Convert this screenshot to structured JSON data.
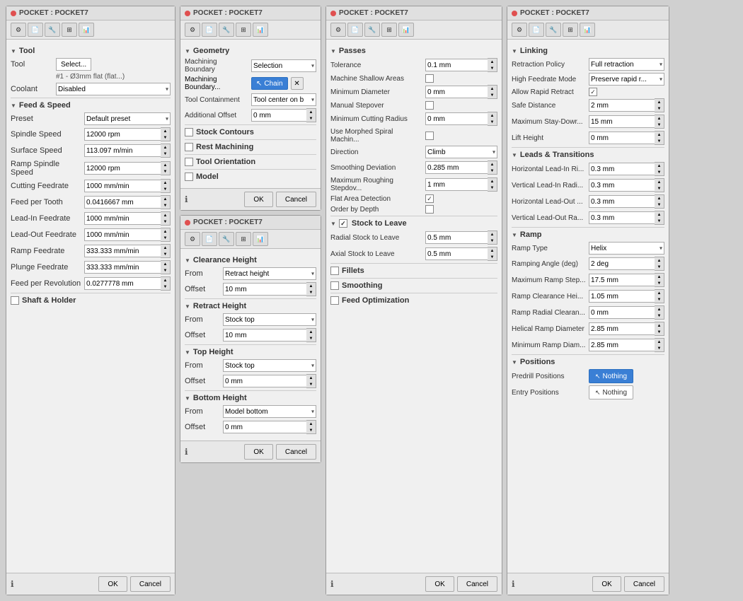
{
  "panels": {
    "panel1": {
      "title": "POCKET : POCKET7",
      "toolbar_icons": [
        "tool-icon",
        "doc-icon",
        "settings-icon",
        "grid-icon",
        "chart-icon"
      ],
      "sections": {
        "tool": {
          "label": "Tool",
          "tool_select": "Select...",
          "tool_desc": "#1 - Ø3mm flat (flat...)",
          "coolant_label": "Coolant",
          "coolant_value": "Disabled"
        },
        "feed_speed": {
          "label": "Feed & Speed",
          "preset_label": "Preset",
          "preset_value": "Default preset",
          "spindle_speed_label": "Spindle Speed",
          "spindle_speed_value": "12000 rpm",
          "surface_speed_label": "Surface Speed",
          "surface_speed_value": "113.097 m/min",
          "ramp_spindle_label": "Ramp Spindle Speed",
          "ramp_spindle_value": "12000 rpm",
          "cutting_feedrate_label": "Cutting Feedrate",
          "cutting_feedrate_value": "1000 mm/min",
          "feed_per_tooth_label": "Feed per Tooth",
          "feed_per_tooth_value": "0.0416667 mm",
          "lead_in_label": "Lead-In Feedrate",
          "lead_in_value": "1000 mm/min",
          "lead_out_label": "Lead-Out Feedrate",
          "lead_out_value": "1000 mm/min",
          "ramp_feedrate_label": "Ramp Feedrate",
          "ramp_feedrate_value": "333.333 mm/min",
          "plunge_feedrate_label": "Plunge Feedrate",
          "plunge_feedrate_value": "333.333 mm/min",
          "feed_per_rev_label": "Feed per Revolution",
          "feed_per_rev_value": "0.0277778 mm"
        },
        "shaft_holder": {
          "label": "Shaft & Holder"
        }
      },
      "ok_label": "OK",
      "cancel_label": "Cancel"
    },
    "panel2": {
      "title": "POCKET : POCKET7",
      "toolbar_icons": [
        "tool-icon",
        "doc-icon",
        "settings-icon",
        "grid-icon",
        "chart-icon"
      ],
      "sections": {
        "geometry": {
          "label": "Geometry",
          "machining_boundary_label": "Machining Boundary",
          "machining_boundary_value": "Selection",
          "machining_boundary2_label": "Machining Boundary...",
          "chain_label": "Chain",
          "tool_containment_label": "Tool Containment",
          "tool_containment_value": "Tool center on b...",
          "additional_offset_label": "Additional Offset",
          "additional_offset_value": "0 mm"
        },
        "stock_contours": {
          "label": "Stock Contours",
          "checked": false
        },
        "rest_machining": {
          "label": "Rest Machining",
          "checked": false
        },
        "tool_orientation": {
          "label": "Tool Orientation",
          "checked": false
        },
        "model": {
          "label": "Model",
          "checked": false
        }
      },
      "ok_label": "OK",
      "cancel_label": "Cancel"
    },
    "panel3": {
      "title": "POCKET : POCKET7",
      "toolbar_icons": [
        "tool-icon",
        "doc-icon",
        "settings-icon",
        "grid-icon",
        "chart-icon"
      ],
      "sections": {
        "clearance_height": {
          "label": "Clearance Height",
          "from_label": "From",
          "from_value": "Retract height",
          "offset_label": "Offset",
          "offset_value": "10 mm"
        },
        "retract_height": {
          "label": "Retract Height",
          "from_label": "From",
          "from_value": "Stock top",
          "offset_label": "Offset",
          "offset_value": "10 mm"
        },
        "top_height": {
          "label": "Top Height",
          "from_label": "From",
          "from_value": "Stock top",
          "offset_label": "Offset",
          "offset_value": "0 mm"
        },
        "bottom_height": {
          "label": "Bottom Height",
          "from_label": "From",
          "from_value": "Model bottom",
          "offset_label": "Offset",
          "offset_value": "0 mm"
        }
      },
      "ok_label": "OK",
      "cancel_label": "Cancel"
    },
    "panel4": {
      "title": "POCKET : POCKET7",
      "toolbar_icons": [
        "tool-icon",
        "doc-icon",
        "settings-icon",
        "grid-icon",
        "chart-icon"
      ],
      "sections": {
        "passes": {
          "label": "Passes",
          "tolerance_label": "Tolerance",
          "tolerance_value": "0.1 mm",
          "machine_shallow_label": "Machine Shallow Areas",
          "machine_shallow_checked": false,
          "min_diameter_label": "Minimum Diameter",
          "min_diameter_value": "0 mm",
          "manual_stepover_label": "Manual Stepover",
          "manual_stepover_checked": false,
          "min_cutting_radius_label": "Minimum Cutting Radius",
          "min_cutting_radius_value": "0 mm",
          "use_morphed_label": "Use Morphed Spiral Machin...",
          "use_morphed_checked": false,
          "direction_label": "Direction",
          "direction_value": "Climb",
          "smoothing_deviation_label": "Smoothing Deviation",
          "smoothing_deviation_value": "0.285 mm",
          "max_roughing_label": "Maximum Roughing Stepdov...",
          "max_roughing_value": "1 mm",
          "flat_area_label": "Flat Area Detection",
          "flat_area_checked": true,
          "order_by_depth_label": "Order by Depth",
          "order_by_depth_checked": false
        },
        "stock_to_leave": {
          "label": "Stock to Leave",
          "checked": true,
          "radial_label": "Radial Stock to Leave",
          "radial_value": "0.5 mm",
          "axial_label": "Axial Stock to Leave",
          "axial_value": "0.5 mm"
        },
        "fillets": {
          "label": "Fillets",
          "checked": false
        },
        "smoothing": {
          "label": "Smoothing",
          "checked": false
        },
        "feed_optimization": {
          "label": "Feed Optimization",
          "checked": false
        }
      },
      "ok_label": "OK",
      "cancel_label": "Cancel"
    },
    "panel5": {
      "title": "POCKET : POCKET7",
      "toolbar_icons": [
        "tool-icon",
        "doc-icon",
        "settings-icon",
        "grid-icon",
        "chart-icon"
      ],
      "sections": {
        "linking": {
          "label": "Linking",
          "retraction_policy_label": "Retraction Policy",
          "retraction_policy_value": "Full retraction",
          "high_feedrate_label": "High Feedrate Mode",
          "high_feedrate_value": "Preserve rapid r...",
          "allow_rapid_label": "Allow Rapid Retract",
          "allow_rapid_checked": true,
          "safe_distance_label": "Safe Distance",
          "safe_distance_value": "2 mm",
          "max_stay_down_label": "Maximum Stay-Dowr...",
          "max_stay_down_value": "15 mm",
          "lift_height_label": "Lift Height",
          "lift_height_value": "0 mm"
        },
        "leads_transitions": {
          "label": "Leads & Transitions",
          "horiz_lead_in_label": "Horizontal Lead-In Ri...",
          "horiz_lead_in_value": "0.3 mm",
          "vert_lead_in_label": "Vertical Lead-In Radi...",
          "vert_lead_in_value": "0.3 mm",
          "horiz_lead_out_label": "Horizontal Lead-Out ...",
          "horiz_lead_out_value": "0.3 mm",
          "vert_lead_out_label": "Vertical Lead-Out Ra...",
          "vert_lead_out_value": "0.3 mm"
        },
        "ramp": {
          "label": "Ramp",
          "ramp_type_label": "Ramp Type",
          "ramp_type_value": "Helix",
          "ramping_angle_label": "Ramping Angle (deg)",
          "ramping_angle_value": "2 deg",
          "max_ramp_step_label": "Maximum Ramp Step...",
          "max_ramp_step_value": "17.5 mm",
          "ramp_clearance_label": "Ramp Clearance Hei...",
          "ramp_clearance_value": "1.05 mm",
          "ramp_radial_label": "Ramp Radial Clearan...",
          "ramp_radial_value": "0 mm",
          "helical_ramp_label": "Helical Ramp Diameter",
          "helical_ramp_value": "2.85 mm",
          "min_ramp_label": "Minimum Ramp Diam...",
          "min_ramp_value": "2.85 mm"
        },
        "positions": {
          "label": "Positions",
          "predrill_label": "Predrill Positions",
          "predrill_value": "Nothing",
          "entry_label": "Entry Positions",
          "entry_value": "Nothing"
        }
      },
      "ok_label": "OK",
      "cancel_label": "Cancel"
    }
  }
}
